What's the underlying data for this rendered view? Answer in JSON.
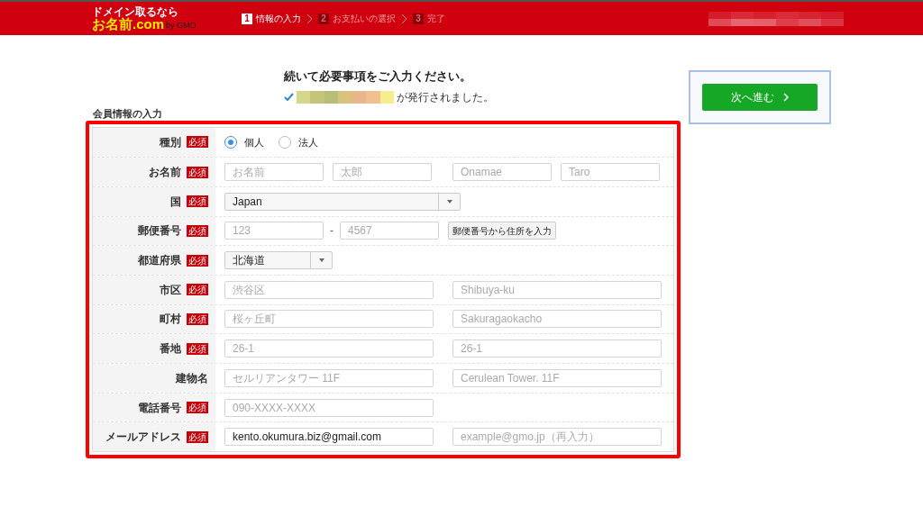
{
  "header": {
    "logo": {
      "tagline": "ドメイン取るなら",
      "name": "お名前.com",
      "by": "by GMO"
    },
    "steps": [
      {
        "number": "1",
        "label": "情報の入力",
        "selected": true
      },
      {
        "number": "2",
        "label": "お支払いの選択",
        "selected": false
      },
      {
        "number": "3",
        "label": "完了",
        "selected": false
      }
    ]
  },
  "message": {
    "title": "続いて必要事項をご入力ください。",
    "issued": "が発行されました。"
  },
  "next_button": "次へ進む",
  "section_title": "会員情報の入力",
  "rows": [
    {
      "label": "種別",
      "badge": "必須",
      "kind": "radio",
      "options": [
        {
          "label": "個人",
          "selected": true
        },
        {
          "label": "法人",
          "selected": false
        }
      ]
    },
    {
      "label": "お名前",
      "badge": "必須",
      "kind": "name",
      "fields": [
        {
          "placeholder": "お名前"
        },
        {
          "placeholder": "太郎"
        },
        {
          "placeholder": "Onamae"
        },
        {
          "placeholder": "Taro"
        }
      ]
    },
    {
      "label": "国",
      "badge": "必須",
      "kind": "select",
      "value": "Japan"
    },
    {
      "label": "郵便番号",
      "badge": "必須",
      "kind": "zip",
      "fields": [
        {
          "placeholder": "123"
        },
        {
          "placeholder": "4567"
        }
      ],
      "separator": "-",
      "button": "郵便番号から住所を入力"
    },
    {
      "label": "都道府県",
      "badge": "必須",
      "kind": "shortselect",
      "value": "北海道"
    },
    {
      "label": "市区",
      "badge": "必須",
      "kind": "pair",
      "fields": [
        {
          "placeholder": "渋谷区"
        },
        {
          "placeholder": "Shibuya-ku"
        }
      ]
    },
    {
      "label": "町村",
      "badge": "必須",
      "kind": "pair",
      "fields": [
        {
          "placeholder": "桜ヶ丘町"
        },
        {
          "placeholder": "Sakuragaokacho"
        }
      ]
    },
    {
      "label": "番地",
      "badge": "必須",
      "kind": "pair",
      "fields": [
        {
          "placeholder": "26-1"
        },
        {
          "placeholder": "26-1"
        }
      ]
    },
    {
      "label": "建物名",
      "kind": "pair",
      "fields": [
        {
          "placeholder": "セルリアンタワー 11F"
        },
        {
          "placeholder": "Cerulean Tower. 11F"
        }
      ]
    },
    {
      "label": "電話番号",
      "badge": "必須",
      "kind": "pair",
      "fields": [
        {
          "placeholder": "090-XXXX-XXXX"
        }
      ]
    },
    {
      "label": "メールアドレス",
      "badge": "必須",
      "kind": "pair",
      "fields": [
        {
          "value": "kento.okumura.biz@gmail.com"
        },
        {
          "placeholder": "example@gmo.jp（再入力）"
        }
      ]
    }
  ]
}
